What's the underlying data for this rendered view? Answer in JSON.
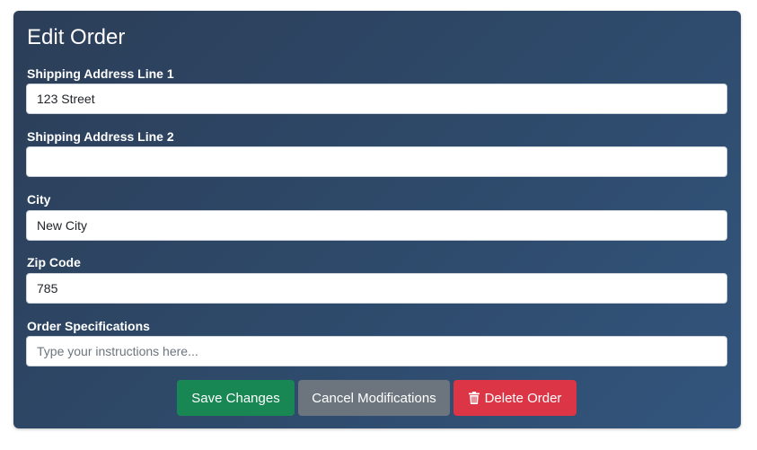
{
  "form": {
    "title": "Edit Order",
    "fields": [
      {
        "label": "Shipping Address Line 1",
        "value": "123 Street",
        "placeholder": ""
      },
      {
        "label": "Shipping Address Line 2",
        "value": "",
        "placeholder": ""
      },
      {
        "label": "City",
        "value": "New City",
        "placeholder": ""
      },
      {
        "label": "Zip Code",
        "value": "785",
        "placeholder": ""
      },
      {
        "label": "Order Specifications",
        "value": "",
        "placeholder": "Type your instructions here..."
      }
    ]
  },
  "actions": {
    "save_label": "Save Changes",
    "cancel_label": "Cancel Modifications",
    "delete_label": "Delete Order",
    "delete_icon": "trash-icon"
  },
  "colors": {
    "save": "#198754",
    "cancel": "#6c757d",
    "delete": "#dc3545",
    "card": "#2e4a6b"
  }
}
